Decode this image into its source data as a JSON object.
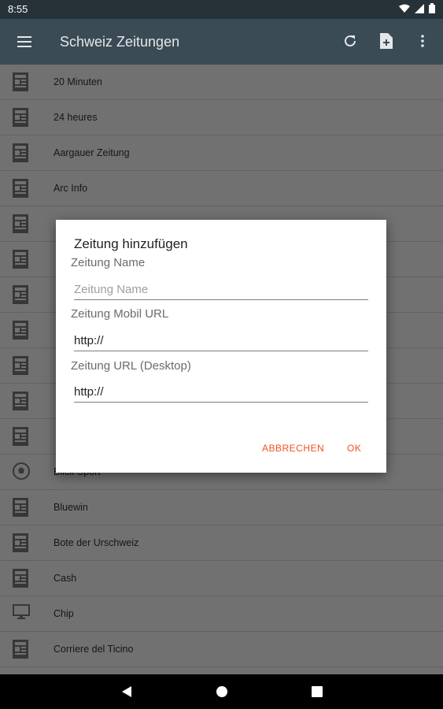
{
  "status_bar": {
    "time": "8:55"
  },
  "app_bar": {
    "title": "Schweiz Zeitungen",
    "bg_color": "#3b4b55"
  },
  "list": {
    "items": [
      {
        "label": "20 Minuten",
        "icon": "newspaper-icon"
      },
      {
        "label": "24 heures",
        "icon": "newspaper-icon"
      },
      {
        "label": "Aargauer Zeitung",
        "icon": "newspaper-icon"
      },
      {
        "label": "Arc Info",
        "icon": "newspaper-icon"
      },
      {
        "label": "",
        "icon": "newspaper-icon"
      },
      {
        "label": "",
        "icon": "newspaper-icon"
      },
      {
        "label": "",
        "icon": "newspaper-icon"
      },
      {
        "label": "",
        "icon": "newspaper-icon"
      },
      {
        "label": "",
        "icon": "newspaper-icon"
      },
      {
        "label": "",
        "icon": "newspaper-icon"
      },
      {
        "label": "",
        "icon": "newspaper-icon"
      },
      {
        "label": "Blick Sport",
        "icon": "soccer-ball-icon"
      },
      {
        "label": "Bluewin",
        "icon": "newspaper-icon"
      },
      {
        "label": "Bote der Urschweiz",
        "icon": "newspaper-icon"
      },
      {
        "label": "Cash",
        "icon": "newspaper-icon"
      },
      {
        "label": "Chip",
        "icon": "monitor-icon"
      },
      {
        "label": "Corriere del Ticino",
        "icon": "newspaper-icon"
      }
    ]
  },
  "dialog": {
    "title": "Zeitung hinzufügen",
    "name_label": "Zeitung Name",
    "name_placeholder": "Zeitung Name",
    "name_value": "",
    "mobile_label": "Zeitung Mobil URL",
    "mobile_value": "http://",
    "desktop_label": "Zeitung URL (Desktop)",
    "desktop_value": "http://",
    "cancel_label": "ABBRECHEN",
    "ok_label": "OK",
    "accent_color": "#f4511e"
  }
}
